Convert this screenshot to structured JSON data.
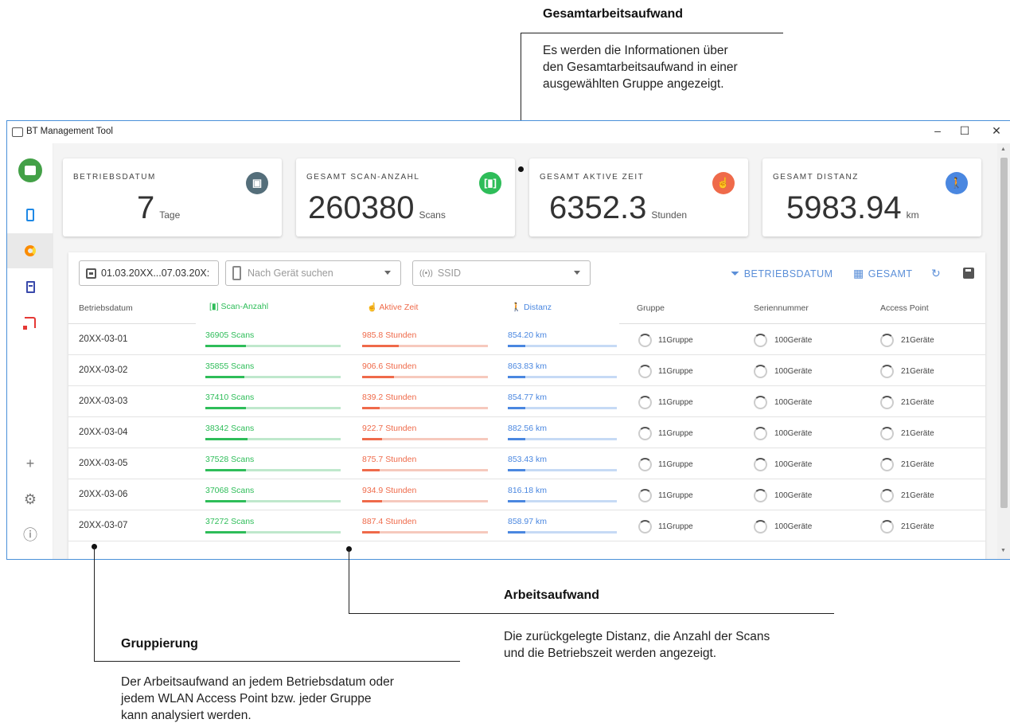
{
  "annotations": {
    "total": {
      "title": "Gesamtarbeitsaufwand",
      "lines": [
        "Es werden die Informationen über",
        "den Gesamtarbeitsaufwand in einer",
        "ausgewählten Gruppe angezeigt."
      ]
    },
    "work": {
      "title": "Arbeitsaufwand",
      "lines": [
        "Die zurückgelegte Distanz, die Anzahl der Scans",
        "und die Betriebszeit werden angezeigt."
      ]
    },
    "group": {
      "title": "Gruppierung",
      "lines": [
        "Der Arbeitsaufwand an jedem Betriebsdatum oder",
        "jedem WLAN Access Point bzw. jeder Gruppe",
        "kann analysiert werden."
      ]
    }
  },
  "window": {
    "title": "BT Management Tool",
    "minimize": "–",
    "maximize": "☐",
    "close": "✕"
  },
  "sidebar": {
    "add": "+",
    "settings": "⚙",
    "info": "ⓘ"
  },
  "cards": [
    {
      "label": "BETRIEBSDATUM",
      "value": "7",
      "unit": "Tage",
      "icon": "calendar-icon",
      "color": "#546e7a"
    },
    {
      "label": "GESAMT SCAN-ANZAHL",
      "value": "260380",
      "unit": "Scans",
      "icon": "scan-icon",
      "color": "#2ebd59"
    },
    {
      "label": "GESAMT AKTIVE ZEIT",
      "value": "6352.3",
      "unit": "Stunden",
      "icon": "touch-icon",
      "color": "#ef6a4a"
    },
    {
      "label": "GESAMT DISTANZ",
      "value": "5983.94",
      "unit": "km",
      "icon": "walk-icon",
      "color": "#4a87e0"
    }
  ],
  "filters": {
    "date_range": "01.03.20XX...07.03.20X:",
    "device_placeholder": "Nach Gerät suchen",
    "ssid_placeholder": "SSID"
  },
  "toolbar": {
    "filter_label": "BETRIEBSDATUM",
    "total_label": "GESAMT"
  },
  "table": {
    "headers": {
      "date": "Betriebsdatum",
      "scans": "Scan-Anzahl",
      "active": "Aktive Zeit",
      "distance": "Distanz",
      "group": "Gruppe",
      "serial": "Seriennummer",
      "ap": "Access Point"
    },
    "rows": [
      {
        "date": "20XX-03-01",
        "scans": "36905 Scans",
        "scans_fill": 0.3,
        "active": "985.8 Stunden",
        "active_fill": 0.29,
        "distance": "854.20 km",
        "distance_fill": 0.16,
        "group": "11Gruppe",
        "serial": "100Geräte",
        "ap": "21Geräte"
      },
      {
        "date": "20XX-03-02",
        "scans": "35855 Scans",
        "scans_fill": 0.29,
        "active": "906.6 Stunden",
        "active_fill": 0.25,
        "distance": "863.83 km",
        "distance_fill": 0.16,
        "group": "11Gruppe",
        "serial": "100Geräte",
        "ap": "21Geräte"
      },
      {
        "date": "20XX-03-03",
        "scans": "37410 Scans",
        "scans_fill": 0.3,
        "active": "839.2 Stunden",
        "active_fill": 0.14,
        "distance": "854.77 km",
        "distance_fill": 0.16,
        "group": "11Gruppe",
        "serial": "100Geräte",
        "ap": "21Geräte"
      },
      {
        "date": "20XX-03-04",
        "scans": "38342 Scans",
        "scans_fill": 0.31,
        "active": "922.7 Stunden",
        "active_fill": 0.16,
        "distance": "882.56 km",
        "distance_fill": 0.16,
        "group": "11Gruppe",
        "serial": "100Geräte",
        "ap": "21Geräte"
      },
      {
        "date": "20XX-03-05",
        "scans": "37528 Scans",
        "scans_fill": 0.3,
        "active": "875.7 Stunden",
        "active_fill": 0.14,
        "distance": "853.43 km",
        "distance_fill": 0.16,
        "group": "11Gruppe",
        "serial": "100Geräte",
        "ap": "21Geräte"
      },
      {
        "date": "20XX-03-06",
        "scans": "37068 Scans",
        "scans_fill": 0.3,
        "active": "934.9 Stunden",
        "active_fill": 0.16,
        "distance": "816.18 km",
        "distance_fill": 0.16,
        "group": "11Gruppe",
        "serial": "100Geräte",
        "ap": "21Geräte"
      },
      {
        "date": "20XX-03-07",
        "scans": "37272 Scans",
        "scans_fill": 0.3,
        "active": "887.4 Stunden",
        "active_fill": 0.14,
        "distance": "858.97 km",
        "distance_fill": 0.16,
        "group": "11Gruppe",
        "serial": "100Geräte",
        "ap": "21Geräte"
      }
    ]
  },
  "colors": {
    "scans": "#2ebd59",
    "scans_track": "#bfe8cc",
    "active": "#ef6a4a",
    "active_track": "#f6c9bd",
    "distance": "#4a87e0",
    "distance_track": "#c6daf5"
  }
}
